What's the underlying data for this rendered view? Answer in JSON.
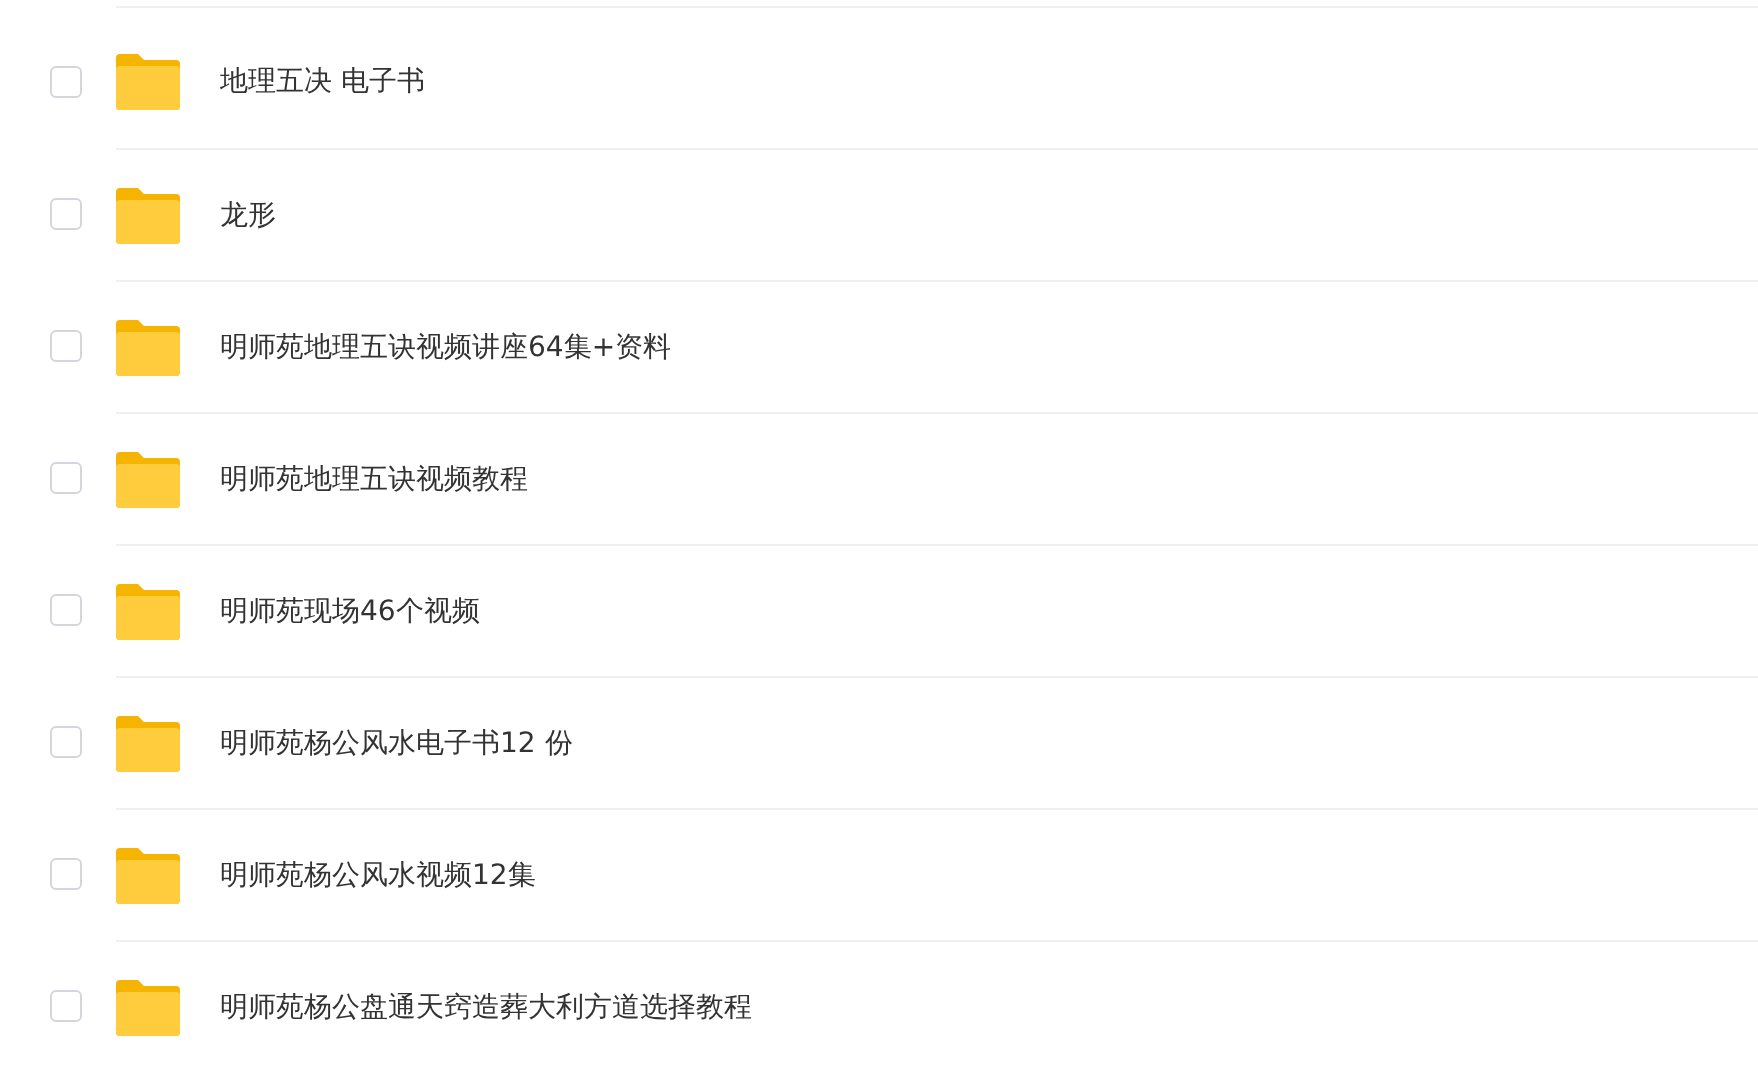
{
  "files": [
    {
      "name": "地理五决 电子书",
      "checked": false
    },
    {
      "name": "龙形",
      "checked": false
    },
    {
      "name": "明师苑地理五诀视频讲座64集+资料",
      "checked": false
    },
    {
      "name": "明师苑地理五诀视频教程",
      "checked": false
    },
    {
      "name": "明师苑现场46个视频",
      "checked": false
    },
    {
      "name": "明师苑杨公风水电子书12 份",
      "checked": false
    },
    {
      "name": "明师苑杨公风水视频12集",
      "checked": false
    },
    {
      "name": "明师苑杨公盘通天窍造葬大利方道选择教程",
      "checked": false
    }
  ]
}
